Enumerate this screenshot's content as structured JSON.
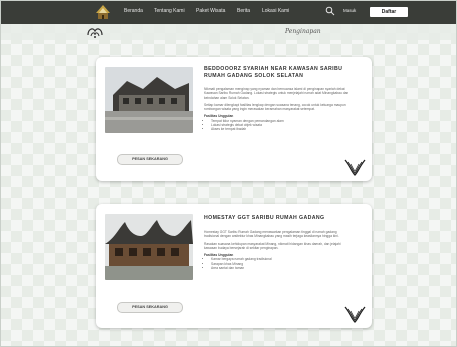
{
  "nav": {
    "links": [
      "Beranda",
      "Tentang Kami",
      "Paket Wisata",
      "Berita",
      "Lokasi Kami"
    ],
    "login_label": "Masuk",
    "cta_label": "Daftar"
  },
  "page_title": "Penginapan",
  "cards": [
    {
      "title": "BEDDOOORZ SYARIAH NEAR KAWASAN SARIBU RUMAH GADANG SOLOK SELATAN",
      "paragraphs": [
        "Nikmati pengalaman menginap yang nyaman dan bernuansa islami di penginapan syariah dekat Kawasan Saribu Rumah Gadang. Lokasi strategis untuk menjelajahi rumah adat Minangkabau dan keindahan alam Solok Selatan.",
        "Setiap kamar dilengkapi fasilitas lengkap dengan suasana tenang, cocok untuk keluarga maupun rombongan wisata yang ingin merasakan keramahan masyarakat setempat."
      ],
      "section_label": "Fasilitas Unggulan",
      "facilities": [
        "Tempat tidur nyaman dengan pemandangan alam",
        "Lokasi strategis dekat objek wisata",
        "Akses ke tempat ibadah"
      ],
      "button_label": "PESAN SEKARANG"
    },
    {
      "title": "HOMESTAY GGT SARIBU RUMAH GADANG",
      "paragraphs": [
        "Homestay GGT Saribu Rumah Gadang menawarkan pengalaman tinggal di rumah gadang tradisional dengan arsitektur khas Minangkabau yang masih terjaga keasliannya hingga kini.",
        "Rasakan suasana kehidupan masyarakat Minang, nikmati hidangan khas daerah, dan jelajahi kawasan budaya bersejarah di sekitar penginapan."
      ],
      "section_label": "Fasilitas Unggulan",
      "facilities": [
        "Kamar bergaya rumah gadang tradisional",
        "Sarapan khas Minang",
        "Area santai dan taman"
      ],
      "button_label": "PESAN SEKARANG"
    }
  ]
}
